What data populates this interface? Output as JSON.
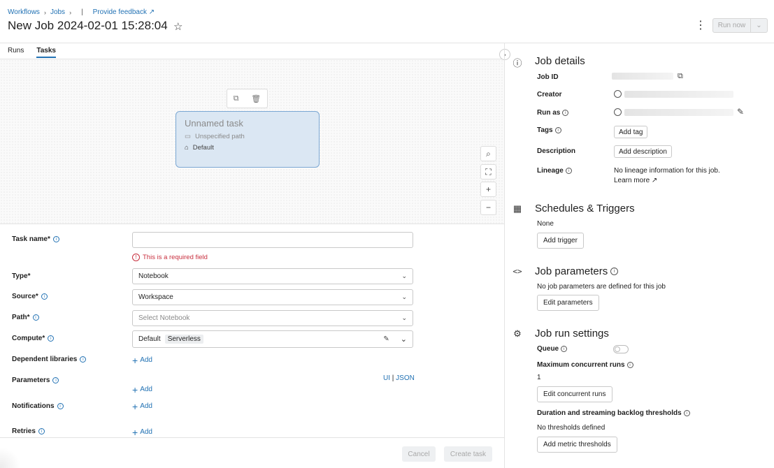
{
  "header": {
    "breadcrumb": [
      "Workflows",
      "Jobs"
    ],
    "feedback": "Provide feedback",
    "title": "New Job 2024-02-01 15:28:04",
    "run_now": "Run now"
  },
  "tabs": [
    {
      "label": "Runs"
    },
    {
      "label": "Tasks"
    }
  ],
  "canvas": {
    "node_name": "Unnamed task",
    "node_path": "Unspecified path",
    "node_compute": "Default"
  },
  "form": {
    "task_name_label": "Task name*",
    "task_name_value": "",
    "error": "This is a required field",
    "type_label": "Type*",
    "type_value": "Notebook",
    "source_label": "Source*",
    "source_value": "Workspace",
    "path_label": "Path*",
    "path_placeholder": "Select Notebook",
    "compute_label": "Compute*",
    "compute_value": "Default",
    "compute_chip": "Serverless",
    "dependent_label": "Dependent libraries",
    "parameters_label": "Parameters",
    "notifications_label": "Notifications",
    "retries_label": "Retries",
    "add": "Add",
    "ui": "UI",
    "json": "JSON",
    "cancel": "Cancel",
    "create": "Create task"
  },
  "details": {
    "title": "Job details",
    "job_id": "Job ID",
    "creator": "Creator",
    "run_as": "Run as",
    "tags": "Tags",
    "add_tag": "Add tag",
    "description": "Description",
    "add_description": "Add description",
    "lineage": "Lineage",
    "lineage_text": "No lineage information for this job.",
    "learn_more": "Learn more"
  },
  "schedules": {
    "title": "Schedules & Triggers",
    "none": "None",
    "add_trigger": "Add trigger"
  },
  "parameters": {
    "title": "Job parameters",
    "text": "No job parameters are defined for this job",
    "edit": "Edit parameters"
  },
  "run_settings": {
    "title": "Job run settings",
    "queue": "Queue",
    "max_label": "Maximum concurrent runs",
    "max_value": "1",
    "edit_concurrent": "Edit concurrent runs",
    "duration_label": "Duration and streaming backlog thresholds",
    "no_thresholds": "No thresholds defined",
    "add_metric": "Add metric thresholds"
  }
}
